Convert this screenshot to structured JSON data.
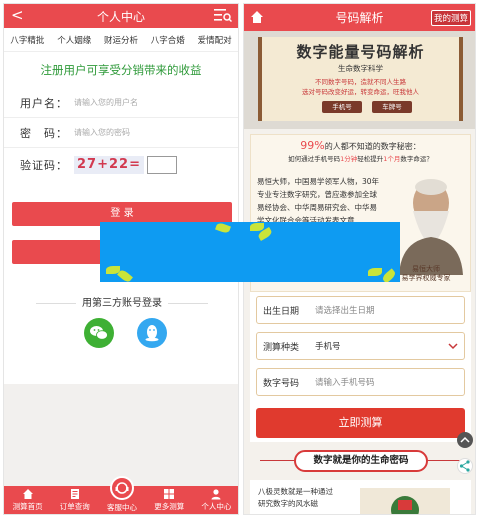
{
  "left": {
    "header": {
      "back": "<",
      "title": "个人中心"
    },
    "tabs": [
      "八字精批",
      "个人姻缘",
      "财运分析",
      "八字合婚",
      "爱情配对"
    ],
    "promo": "注册用户可享受分销带来的收益",
    "form": {
      "username_label": "用户名：",
      "username_placeholder": "请输入您的用户名",
      "password_label": "密　码：",
      "password_placeholder": "请输入您的密码",
      "captcha_label": "验证码：",
      "captcha_text": "27+22="
    },
    "login_label": "登 录",
    "third_party_title": "用第三方账号登录",
    "bottom_nav": [
      {
        "label": "测算首页",
        "icon": "home-icon"
      },
      {
        "label": "订单查询",
        "icon": "order-icon"
      },
      {
        "label": "客服中心",
        "icon": "service-icon"
      },
      {
        "label": "更多测算",
        "icon": "grid-icon"
      },
      {
        "label": "个人中心",
        "icon": "user-icon"
      }
    ]
  },
  "right": {
    "header": {
      "title": "号码解析",
      "my_button": "我的测算"
    },
    "banner": {
      "title": "数字能量号码解析",
      "subtitle": "生命数字科学",
      "line1": "不同数字号码，造就不同人生路",
      "line2": "选对号码改变好运，转变命运，旺我他人",
      "btn_phone": "手机号",
      "btn_plate": "车牌号"
    },
    "intro": {
      "pct": "99%",
      "headline": "的人都不知道的数字秘密",
      "headline_end": "：",
      "line2_a": "如何通过手机号码",
      "line2_red1": "1分钟",
      "line2_b": "轻松提升",
      "line2_red2": "1个月",
      "line2_c": "数字命运？",
      "body": "易恒大师，中国易学领军人物，30年专业专注数字研究，曾应邀参加全球易经协会、中华周易研究会、中华易学文化联合会等活动发表文章",
      "master_caption_1": "易恒大师",
      "master_caption_2": "易学界权威专家"
    },
    "calc_form": {
      "birth_label": "出生日期",
      "birth_placeholder": "请选择出生日期",
      "type_label": "测算种类",
      "type_value": "手机号",
      "number_label": "数字号码",
      "number_placeholder": "请输入手机号码",
      "submit": "立即测算"
    },
    "section_title": "数字就是你的生命密码",
    "bottom_text": "八极灵数就是一种通过研究数字的风水磁"
  },
  "colors": {
    "brand_red": "#e94a4e",
    "promo_green": "#2f9a3a",
    "overlay_blue": "#0e9bf2"
  }
}
